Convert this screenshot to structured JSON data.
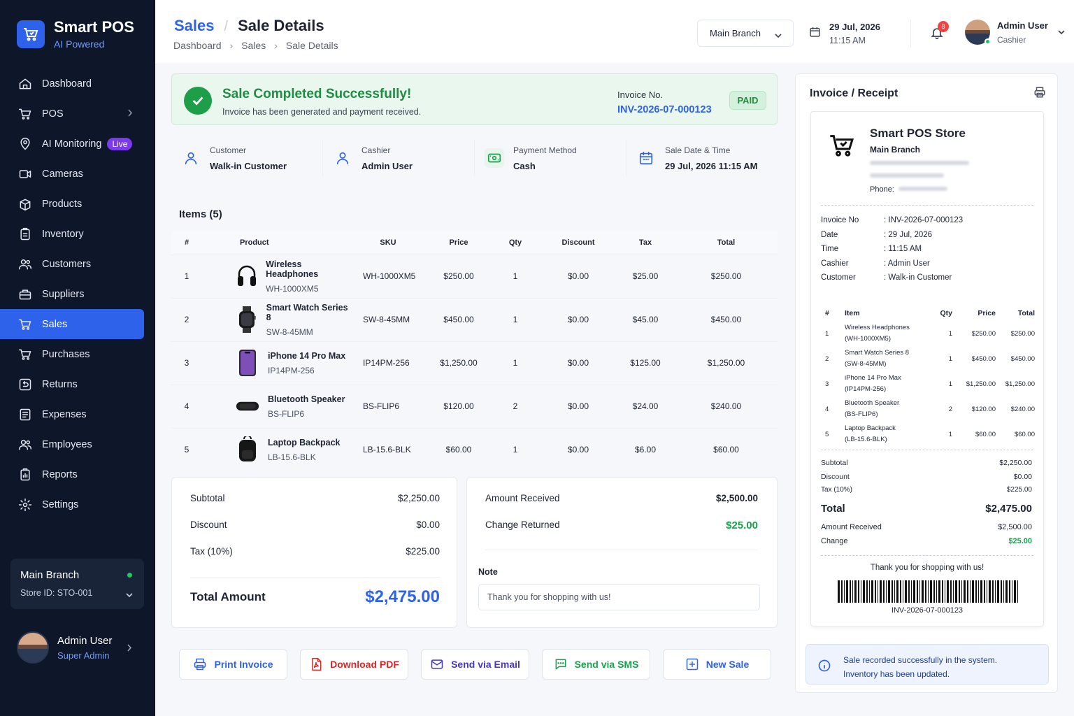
{
  "brand": {
    "name": "Smart POS",
    "sub": "AI Powered"
  },
  "nav": [
    {
      "label": "Dashboard",
      "icon": "home-icon"
    },
    {
      "label": "POS",
      "icon": "cart-icon",
      "chevron": true
    },
    {
      "label": "AI Monitoring",
      "icon": "ai-monitor-icon",
      "badge": "Live"
    },
    {
      "label": "Cameras",
      "icon": "camera-icon"
    },
    {
      "label": "Products",
      "icon": "box-icon"
    },
    {
      "label": "Inventory",
      "icon": "inventory-icon"
    },
    {
      "label": "Customers",
      "icon": "users-icon"
    },
    {
      "label": "Suppliers",
      "icon": "supplier-icon"
    },
    {
      "label": "Sales",
      "icon": "cart-icon",
      "active": true
    },
    {
      "label": "Purchases",
      "icon": "cart-icon"
    },
    {
      "label": "Returns",
      "icon": "return-icon"
    },
    {
      "label": "Expenses",
      "icon": "expense-icon"
    },
    {
      "label": "Employees",
      "icon": "employees-icon"
    },
    {
      "label": "Reports",
      "icon": "report-icon"
    },
    {
      "label": "Settings",
      "icon": "gear-icon"
    }
  ],
  "branch_card": {
    "name": "Main Branch",
    "store_id": "Store ID: STO-001"
  },
  "side_user": {
    "name": "Admin User",
    "role": "Super Admin"
  },
  "header": {
    "title_section": "Sales",
    "title_page": "Sale Details",
    "crumbs": [
      "Dashboard",
      "Sales",
      "Sale Details"
    ],
    "branch": "Main Branch",
    "date": "29 Jul, 2026",
    "time": "11:15 AM",
    "notifications": "8",
    "user_name": "Admin User",
    "user_role": "Cashier"
  },
  "success": {
    "title": "Sale Completed Successfully!",
    "sub": "Invoice has been generated and payment received.",
    "invoice_label": "Invoice No.",
    "invoice_no": "INV-2026-07-000123",
    "status": "PAID"
  },
  "info": [
    {
      "label": "Customer",
      "value": "Walk-in Customer",
      "icon": "user-icon"
    },
    {
      "label": "Cashier",
      "value": "Admin User",
      "icon": "user-icon"
    },
    {
      "label": "Payment Method",
      "value": "Cash",
      "icon": "cash-icon"
    },
    {
      "label": "Sale Date & Time",
      "value": "29 Jul, 2026 11:15 AM",
      "icon": "calendar-icon"
    }
  ],
  "items_title": "Items (5)",
  "columns": [
    "#",
    "Product",
    "SKU",
    "Price",
    "Qty",
    "Discount",
    "Tax",
    "Total"
  ],
  "items": [
    {
      "n": "1",
      "name": "Wireless Headphones",
      "sku": "WH-1000XM5",
      "price": "$250.00",
      "qty": "1",
      "discount": "$0.00",
      "tax": "$25.00",
      "total": "$250.00",
      "icon": "headphones-icon"
    },
    {
      "n": "2",
      "name": "Smart Watch Series 8",
      "sku": "SW-8-45MM",
      "price": "$450.00",
      "qty": "1",
      "discount": "$0.00",
      "tax": "$45.00",
      "total": "$450.00",
      "icon": "watch-icon"
    },
    {
      "n": "3",
      "name": "iPhone 14 Pro Max",
      "sku": "IP14PM-256",
      "price": "$1,250.00",
      "qty": "1",
      "discount": "$0.00",
      "tax": "$125.00",
      "total": "$1,250.00",
      "icon": "phone-icon"
    },
    {
      "n": "4",
      "name": "Bluetooth Speaker",
      "sku": "BS-FLIP6",
      "price": "$120.00",
      "qty": "2",
      "discount": "$0.00",
      "tax": "$24.00",
      "total": "$240.00",
      "icon": "speaker-icon"
    },
    {
      "n": "5",
      "name": "Laptop Backpack",
      "sku": "LB-15.6-BLK",
      "price": "$60.00",
      "qty": "1",
      "discount": "$0.00",
      "tax": "$6.00",
      "total": "$60.00",
      "icon": "backpack-icon"
    }
  ],
  "totals": {
    "subtotal_label": "Subtotal",
    "subtotal": "$2,250.00",
    "discount_label": "Discount",
    "discount": "$0.00",
    "tax_label": "Tax (10%)",
    "tax": "$225.00",
    "total_label": "Total Amount",
    "total": "$2,475.00"
  },
  "payment": {
    "received_label": "Amount Received",
    "received": "$2,500.00",
    "change_label": "Change Returned",
    "change": "$25.00",
    "note_label": "Note",
    "note": "Thank you for shopping with us!"
  },
  "actions": [
    {
      "label": "Print Invoice",
      "icon": "printer-icon",
      "color": "#2f62ea"
    },
    {
      "label": "Download PDF",
      "icon": "pdf-icon",
      "color": "#dc2626"
    },
    {
      "label": "Send via Email",
      "icon": "mail-icon",
      "color": "#4338ca"
    },
    {
      "label": "Send via SMS",
      "icon": "chat-icon",
      "color": "#16a34a"
    },
    {
      "label": "New Sale",
      "icon": "plus-box-icon",
      "color": "#2f62ea"
    }
  ],
  "receipt": {
    "panel_title": "Invoice / Receipt",
    "store": "Smart POS Store",
    "branch": "Main Branch",
    "phone_label": "Phone:",
    "fields": [
      {
        "k": "Invoice No",
        "v": ": INV-2026-07-000123"
      },
      {
        "k": "Date",
        "v": ": 29 Jul, 2026"
      },
      {
        "k": "Time",
        "v": ": 11:15 AM"
      },
      {
        "k": "Cashier",
        "v": ": Admin User"
      },
      {
        "k": "Customer",
        "v": ": Walk-in Customer"
      }
    ],
    "cols": [
      "#",
      "Item",
      "Qty",
      "Price",
      "Total"
    ],
    "rows": [
      {
        "n": "1",
        "l1": "Wireless Headphones",
        "l2": "(WH-1000XM5)",
        "qty": "1",
        "price": "$250.00",
        "total": "$250.00"
      },
      {
        "n": "2",
        "l1": "Smart Watch Series 8",
        "l2": "(SW-8-45MM)",
        "qty": "1",
        "price": "$450.00",
        "total": "$450.00"
      },
      {
        "n": "3",
        "l1": "iPhone 14 Pro Max",
        "l2": "(IP14PM-256)",
        "qty": "1",
        "price": "$1,250.00",
        "total": "$1,250.00"
      },
      {
        "n": "4",
        "l1": "Bluetooth Speaker",
        "l2": "(BS-FLIP6)",
        "qty": "2",
        "price": "$120.00",
        "total": "$240.00"
      },
      {
        "n": "5",
        "l1": "Laptop Backpack",
        "l2": "(LB-15.6-BLK)",
        "qty": "1",
        "price": "$60.00",
        "total": "$60.00"
      }
    ],
    "subtotal_label": "Subtotal",
    "subtotal": "$2,250.00",
    "discount_label": "Discount",
    "discount": "$0.00",
    "tax_label": "Tax (10%)",
    "tax": "$225.00",
    "total_label": "Total",
    "total": "$2,475.00",
    "received_label": "Amount Received",
    "received": "$2,500.00",
    "change_label": "Change",
    "change": "$25.00",
    "thanks": "Thank you for shopping with us!",
    "barcode_no": "INV-2026-07-000123"
  },
  "system_note": {
    "line1": "Sale recorded successfully in the system.",
    "line2": "Inventory has been updated."
  },
  "colors": {
    "accent": "#2f62ea",
    "success": "#1f9e49",
    "sidebar": "#0e1629"
  }
}
